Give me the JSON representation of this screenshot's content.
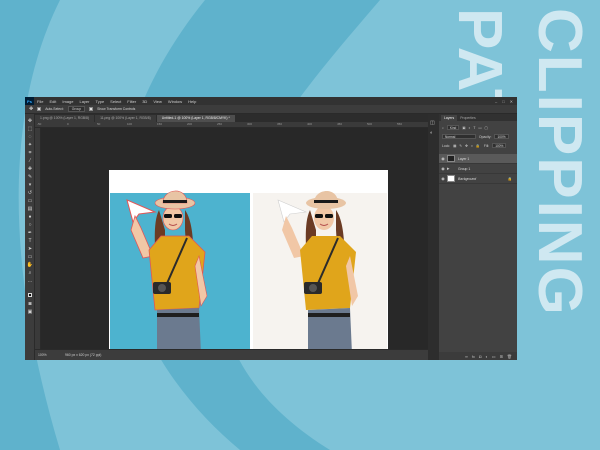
{
  "side_title": "CLIPPING PATH",
  "colors": {
    "background": "#7ec3d8",
    "arc": "#5fb2cc",
    "title": "#cfe8f1",
    "photo_bg": "#4db3cf",
    "photo_bg_right": "#f6f3ef"
  },
  "app": {
    "logo": "Ps",
    "menu": [
      "File",
      "Edit",
      "Image",
      "Layer",
      "Type",
      "Select",
      "Filter",
      "3D",
      "View",
      "Window",
      "Help"
    ],
    "window_controls": [
      "–",
      "□",
      "✕"
    ]
  },
  "options_bar": {
    "auto_select_label": "Auto-Select:",
    "auto_select_value": "Group",
    "show_transform_label": "Show Transform Controls"
  },
  "tabs": [
    {
      "label": "1.png @ 100% (Layer 1, RGB/8)",
      "active": false
    },
    {
      "label": "11.png @ 100% (Layer 1, RGB/8)",
      "active": false
    },
    {
      "label": "Untitled-1 @ 100% (Layer 1, RGB/8/CMYK) *",
      "active": true
    }
  ],
  "ruler_ticks": [
    "-50",
    "0",
    "50",
    "100",
    "150",
    "200",
    "250",
    "300",
    "350",
    "400",
    "450",
    "500",
    "550"
  ],
  "tools": [
    "move-icon",
    "marquee-icon",
    "lasso-icon",
    "magic-wand-icon",
    "crop-icon",
    "eyedropper-icon",
    "healing-icon",
    "brush-icon",
    "stamp-icon",
    "history-brush-icon",
    "eraser-icon",
    "gradient-icon",
    "blur-icon",
    "dodge-icon",
    "pen-icon",
    "type-icon",
    "path-select-icon",
    "shape-icon",
    "hand-icon",
    "zoom-icon",
    "more-icon",
    "colors-icon",
    "quickmask-icon",
    "screenmode-icon"
  ],
  "status": {
    "zoom": "100%",
    "info": "960 px x 620 px (72 ppi)"
  },
  "layers_panel": {
    "tabs": [
      "Layers",
      "Properties"
    ],
    "kind_label": "Kind",
    "blend_mode": "Normal",
    "opacity_label": "Opacity:",
    "opacity_value": "100%",
    "lock_label": "Lock:",
    "fill_label": "Fill:",
    "fill_value": "100%",
    "layers": [
      {
        "name": "Layer 1",
        "active": true,
        "thumb": "dark"
      },
      {
        "name": "Group 1",
        "active": false,
        "thumb": "folder"
      },
      {
        "name": "Background",
        "active": false,
        "thumb": "white"
      }
    ],
    "bottom_icons": [
      "link-icon",
      "fx-icon",
      "mask-icon",
      "adjustment-icon",
      "group-icon",
      "new-layer-icon",
      "trash-icon"
    ]
  }
}
